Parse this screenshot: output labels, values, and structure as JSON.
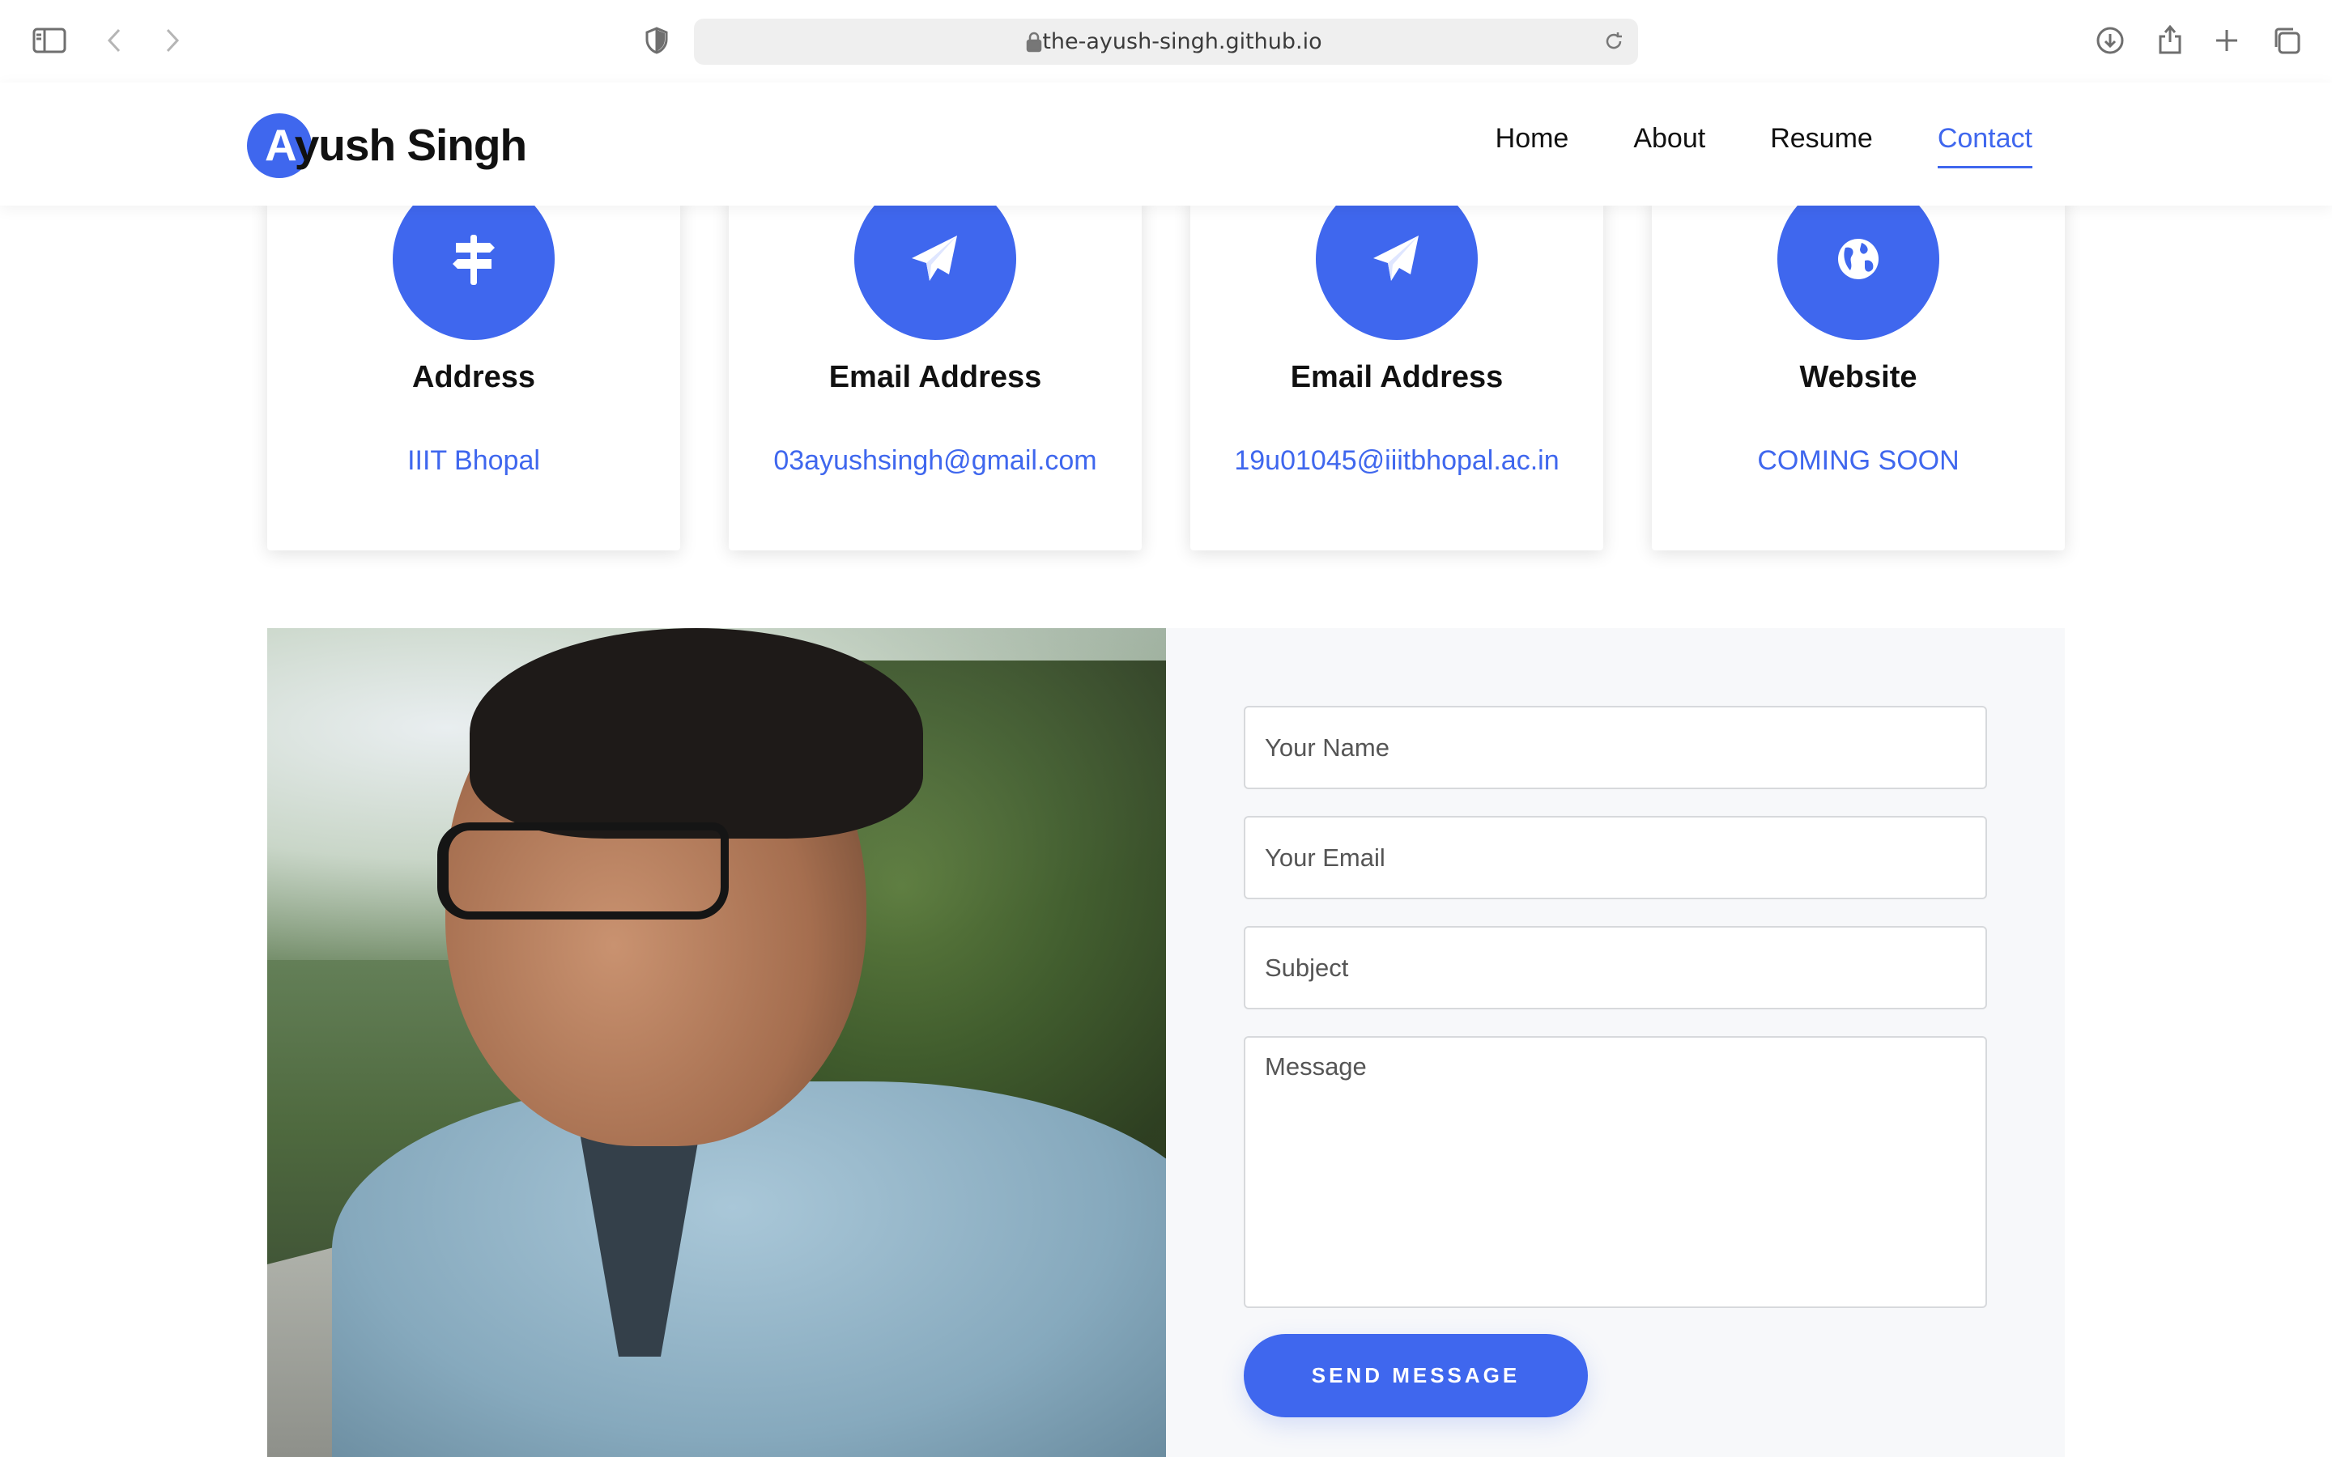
{
  "browser": {
    "url": "the-ayush-singh.github.io"
  },
  "header": {
    "logo_first_letter": "A",
    "logo_rest": "yush Singh",
    "nav": [
      {
        "label": "Home",
        "active": false
      },
      {
        "label": "About",
        "active": false
      },
      {
        "label": "Resume",
        "active": false
      },
      {
        "label": "Contact",
        "active": true
      }
    ]
  },
  "cards": [
    {
      "icon": "signpost-icon",
      "title": "Address",
      "value": "IIIT Bhopal"
    },
    {
      "icon": "paper-plane-icon",
      "title": "Email Address",
      "value": "03ayushsingh@gmail.com"
    },
    {
      "icon": "paper-plane-icon",
      "title": "Email Address",
      "value": "19u01045@iiitbhopal.ac.in"
    },
    {
      "icon": "globe-icon",
      "title": "Website",
      "value": "COMING SOON"
    }
  ],
  "form": {
    "name_placeholder": "Your Name",
    "email_placeholder": "Your Email",
    "subject_placeholder": "Subject",
    "message_placeholder": "Message",
    "submit_label": "SEND MESSAGE"
  },
  "colors": {
    "accent": "#3f67ee"
  }
}
